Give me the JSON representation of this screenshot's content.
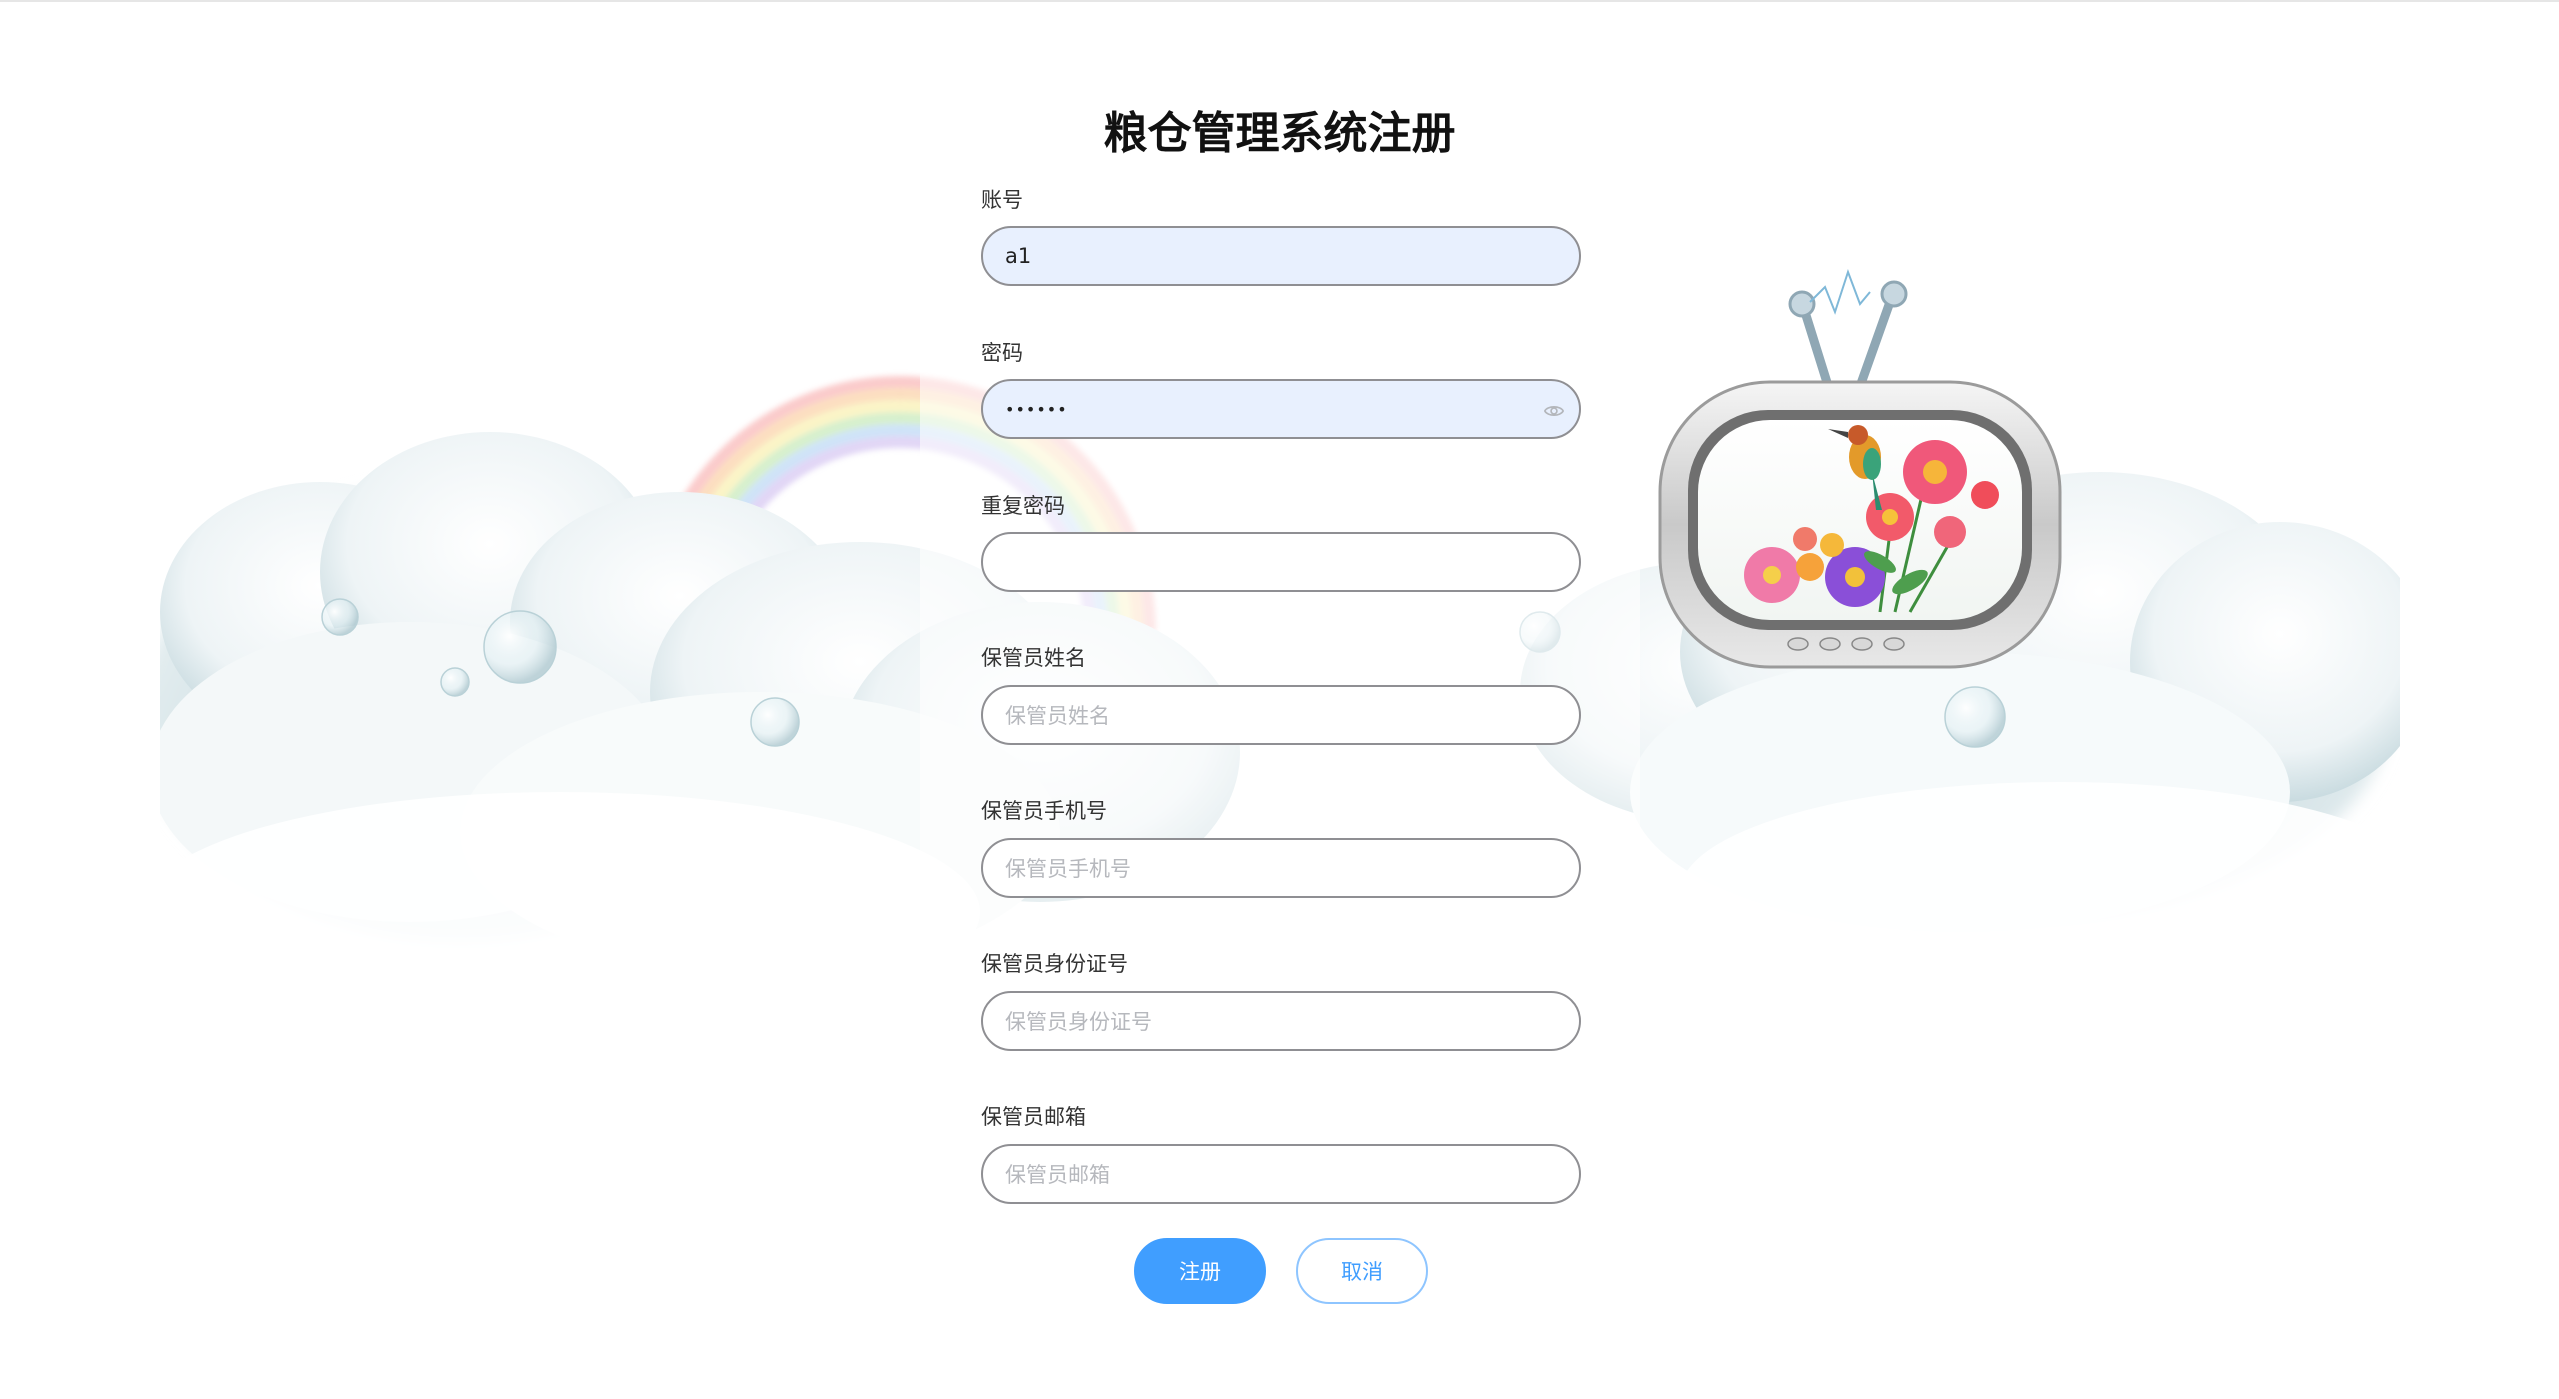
{
  "title": "粮仓管理系统注册",
  "fields": [
    {
      "label": "账号",
      "value": "a1",
      "placeholder": ""
    },
    {
      "label": "密码",
      "value": "••••••",
      "placeholder": ""
    },
    {
      "label": "重复密码",
      "value": "",
      "placeholder": ""
    },
    {
      "label": "保管员姓名",
      "value": "",
      "placeholder": "保管员姓名"
    },
    {
      "label": "保管员手机号",
      "value": "",
      "placeholder": "保管员手机号"
    },
    {
      "label": "保管员身份证号",
      "value": "",
      "placeholder": "保管员身份证号"
    },
    {
      "label": "保管员邮箱",
      "value": "",
      "placeholder": "保管员邮箱"
    }
  ],
  "buttons": {
    "register_label": "注册",
    "cancel_label": "取消"
  },
  "colors": {
    "primary": "#409eff",
    "autofill_bg": "#e8f0fe",
    "input_border": "#8f8f93"
  },
  "icons": {
    "password_toggle": "eye-icon",
    "illustration": "retro-tv-flowers-bird"
  }
}
